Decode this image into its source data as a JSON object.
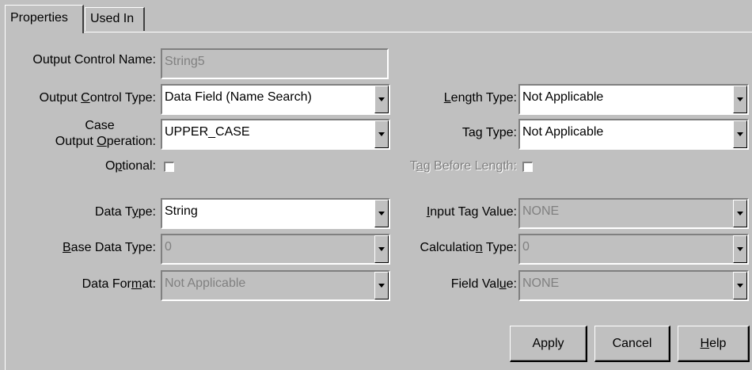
{
  "tabs": [
    {
      "label": "Properties",
      "active": true
    },
    {
      "label": "Used In",
      "active": false
    }
  ],
  "output_control_name": {
    "label": "Output Control Name:",
    "value": "String5"
  },
  "output_control_type": {
    "label_pre": "Output ",
    "label_key": "C",
    "label_post": "ontrol Type:",
    "value": "Data Field (Name Search)"
  },
  "case_output_operation": {
    "label_line1": "Case",
    "label_line2_pre": "Output ",
    "label_key": "O",
    "label_line2_post": "peration:",
    "value": "UPPER_CASE"
  },
  "optional": {
    "label_pre": "O",
    "label_key": "p",
    "label_post": "tional:",
    "checked": false
  },
  "data_type": {
    "label_pre": "Data T",
    "label_key": "y",
    "label_post": "pe:",
    "value": "String"
  },
  "base_data_type": {
    "label_key": "B",
    "label_post": "ase Data Type:",
    "value": "0"
  },
  "data_format": {
    "label_pre": "Data For",
    "label_key": "m",
    "label_post": "at:",
    "value": "Not Applicable"
  },
  "length_type": {
    "label_key": "L",
    "label_post": "ength Type:",
    "value": "Not Applicable"
  },
  "tag_type": {
    "label_pre": "Ta",
    "label_key": "g",
    "label_post": " Type:",
    "value": "Not Applicable"
  },
  "tag_before_length": {
    "label_pre": "T",
    "label_key": "a",
    "label_post": "g Before Length:",
    "checked": false
  },
  "input_tag_value": {
    "label_key": "I",
    "label_post": "nput Tag Value:",
    "value": "NONE"
  },
  "calculation_type": {
    "label_pre": "Calculatio",
    "label_key": "n",
    "label_post": " Type:",
    "value": "0"
  },
  "field_value": {
    "label_pre": "Field Val",
    "label_key": "u",
    "label_post": "e:",
    "value": "NONE"
  },
  "buttons": {
    "apply": "Apply",
    "cancel": "Cancel",
    "help_key": "H",
    "help_post": "elp"
  },
  "icons": {
    "dropdown": "chevron-down-icon",
    "checkbox": "checkbox-unchecked"
  }
}
